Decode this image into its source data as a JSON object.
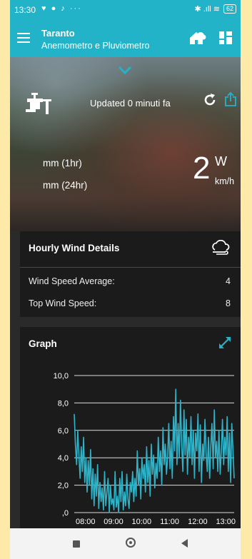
{
  "status_bar": {
    "time": "13:30",
    "notification_icons": "♥ ● ♪ ···",
    "right_icons": "✱ .ıll ≋",
    "battery": "62"
  },
  "app_bar": {
    "station_name": "Taranto",
    "station_subtitle": "Anemometro e Pluviometro"
  },
  "current": {
    "updated_text": "Updated 0 minuti fa",
    "rain_1hr": "mm (1hr)",
    "rain_24hr": "mm (24hr)",
    "wind_value": "2",
    "wind_direction": "W",
    "wind_unit": "km/h"
  },
  "hourly": {
    "title": "Hourly Wind Details",
    "rows": [
      {
        "label": "Wind Speed Average:",
        "value": "4"
      },
      {
        "label": "Top Wind Speed:",
        "value": "8"
      }
    ]
  },
  "graph": {
    "title": "Graph"
  },
  "colors": {
    "accent": "#22b3c9",
    "series": "#2fb3c9",
    "panel": "#191919"
  },
  "chart_data": {
    "type": "line",
    "title": "",
    "xlabel": "",
    "ylabel": "",
    "ylim": [
      0,
      10
    ],
    "yticks": [
      "10,0",
      "8,0",
      "6,0",
      "4,0",
      "2,0",
      ",0"
    ],
    "xticks": [
      "08:00",
      "09:00",
      "10:00",
      "11:00",
      "12:00",
      "13:00"
    ],
    "x_start_hour": 7.6,
    "x_end_hour": 13.3,
    "series": [
      {
        "values": [
          7.2,
          5.0,
          3.5,
          6.0,
          4.2,
          2.5,
          4.8,
          3.0,
          5.5,
          2.2,
          4.0,
          1.5,
          3.8,
          2.0,
          4.6,
          1.0,
          3.2,
          0.5,
          2.8,
          1.2,
          3.5,
          0.3,
          2.2,
          0.8,
          1.8,
          0.2,
          3.0,
          0.5,
          1.5,
          2.5,
          0.0,
          2.0,
          0.6,
          1.0,
          0.2,
          3.0,
          0.4,
          1.2,
          0.0,
          2.5,
          0.8,
          3.0,
          0.2,
          1.5,
          0.5,
          2.8,
          1.0,
          0.3,
          2.2,
          1.5,
          3.0,
          0.8,
          2.5,
          1.2,
          4.5,
          2.0,
          3.2,
          1.0,
          4.0,
          2.5,
          3.5,
          1.5,
          4.8,
          2.2,
          3.8,
          1.2,
          5.0,
          2.8,
          4.2,
          1.8,
          3.6,
          2.5,
          5.5,
          3.0,
          4.5,
          2.0,
          6.2,
          3.5,
          5.0,
          2.8,
          4.0,
          6.5,
          3.2,
          5.2,
          2.5,
          7.0,
          4.5,
          9.0,
          3.5,
          6.5,
          4.0,
          8.2,
          5.0,
          3.0,
          7.5,
          4.2,
          6.8,
          2.8,
          5.5,
          4.0,
          7.0,
          3.5,
          6.0,
          2.5,
          5.8,
          4.5,
          7.2,
          3.0,
          6.4,
          2.2,
          5.0,
          3.8,
          6.8,
          4.2,
          3.0,
          5.5,
          2.5,
          4.8,
          6.5,
          3.2,
          7.5,
          4.0,
          5.2,
          3.0,
          6.0,
          2.8,
          4.5,
          6.8,
          3.5,
          5.5,
          4.2,
          7.0,
          3.0,
          5.8,
          2.2,
          6.5,
          4.5,
          2.5
        ]
      }
    ]
  }
}
